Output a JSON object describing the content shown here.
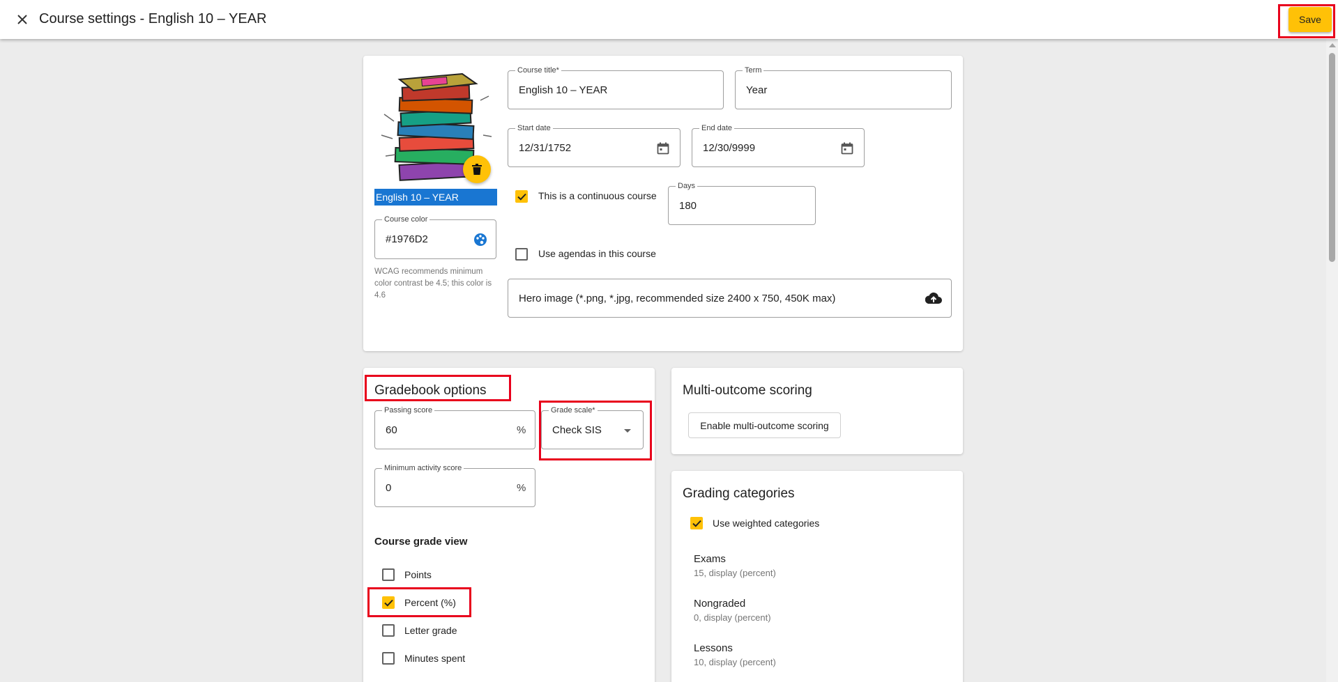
{
  "header": {
    "title": "Course settings - English 10 – YEAR",
    "save_label": "Save"
  },
  "course": {
    "name_tag": "English 10 – YEAR",
    "title_label": "Course title*",
    "title_value": "English 10 – YEAR",
    "term_label": "Term",
    "term_value": "Year",
    "start_date_label": "Start date",
    "start_date_value": "12/31/1752",
    "end_date_label": "End date",
    "end_date_value": "12/30/9999",
    "continuous_label": "This is a continuous course",
    "continuous_checked": true,
    "days_label": "Days",
    "days_value": "180",
    "agendas_label": "Use agendas in this course",
    "agendas_checked": false,
    "hero_image_label": "Hero image (*.png, *.jpg, recommended size 2400 x 750, 450K max)",
    "color_label": "Course color",
    "color_value": "#1976D2",
    "wcag_note": "WCAG recommends minimum color contrast be 4.5; this color is 4.6"
  },
  "gradebook": {
    "title": "Gradebook options",
    "passing_score_label": "Passing score",
    "passing_score_value": "60",
    "percent_suffix": "%",
    "grade_scale_label": "Grade scale*",
    "grade_scale_value": "Check SIS",
    "min_activity_label": "Minimum activity score",
    "min_activity_value": "0",
    "grade_view_title": "Course grade view",
    "grade_view_options": [
      {
        "label": "Points",
        "checked": false
      },
      {
        "label": "Percent (%)",
        "checked": true
      },
      {
        "label": "Letter grade",
        "checked": false
      },
      {
        "label": "Minutes spent",
        "checked": false
      }
    ]
  },
  "multi_outcome": {
    "title": "Multi-outcome scoring",
    "button_label": "Enable multi-outcome scoring"
  },
  "grading_categories": {
    "title": "Grading categories",
    "weighted_label": "Use weighted categories",
    "weighted_checked": true,
    "categories": [
      {
        "name": "Exams",
        "detail": "15, display (percent)"
      },
      {
        "name": "Nongraded",
        "detail": "0, display (percent)"
      },
      {
        "name": "Lessons",
        "detail": "10, display (percent)"
      }
    ]
  },
  "colors": {
    "accent": "#ffc107",
    "course_color": "#1976D2",
    "highlight": "#e8001c"
  }
}
